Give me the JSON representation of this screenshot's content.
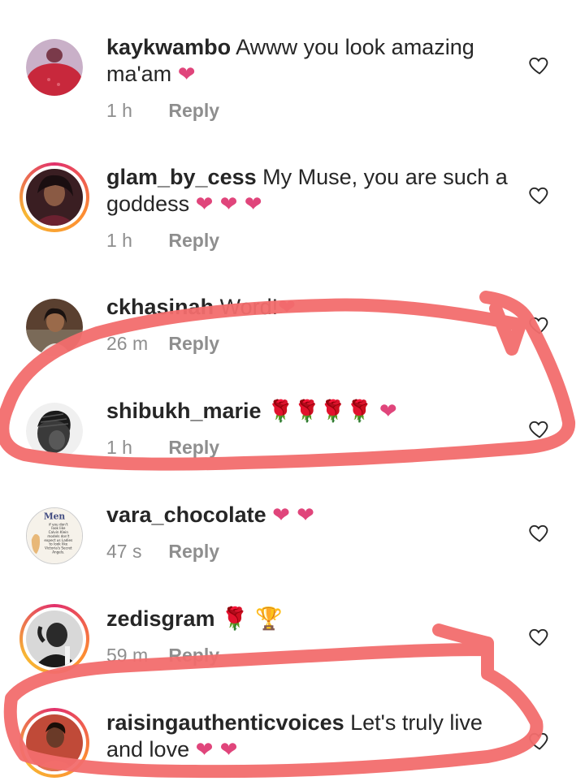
{
  "comments": [
    {
      "username": "kaykwambo",
      "text": "Awww you look amazing ma'am",
      "emoji": "❤",
      "time": "1 h",
      "reply_label": "Reply"
    },
    {
      "username": "glam_by_cess",
      "text": "My Muse, you are such a goddess",
      "emoji": "❤ ❤ ❤",
      "time": "1 h",
      "reply_label": "Reply"
    },
    {
      "username": "ckhasinah",
      "text": "Word!",
      "emoji": "❤",
      "time": "26 m",
      "reply_label": "Reply"
    },
    {
      "username": "shibukh_marie",
      "text": "",
      "emoji": "🌹🌹🌹🌹 ❤",
      "time": "1 h",
      "reply_label": "Reply"
    },
    {
      "username": "vara_chocolate",
      "text": "",
      "emoji": "❤ ❤",
      "time": "47 s",
      "reply_label": "Reply"
    },
    {
      "username": "zedisgram",
      "text": "",
      "emoji": "🌹 🏆",
      "time": "59 m",
      "reply_label": "Reply"
    },
    {
      "username": "raisingauthenticvoices",
      "text": "Let's truly live and love",
      "emoji": "❤ ❤",
      "time": "",
      "reply_label": ""
    }
  ],
  "avatar5_text": "Men If you don't look like Calvin Klein models don't expect us Ladies to look like Victoria's Secret Angels.",
  "icons": {
    "like": "heart-outline-icon",
    "heart_emoji": "heart-emoji-icon",
    "rose_emoji": "rose-emoji-icon",
    "trophy_emoji": "trophy-emoji-icon"
  },
  "colors": {
    "username": "#262626",
    "meta": "#8e8e8e",
    "heart": "#e0457b",
    "annotation_ring": "#f26d6d",
    "story_ring": "#e1306c"
  }
}
